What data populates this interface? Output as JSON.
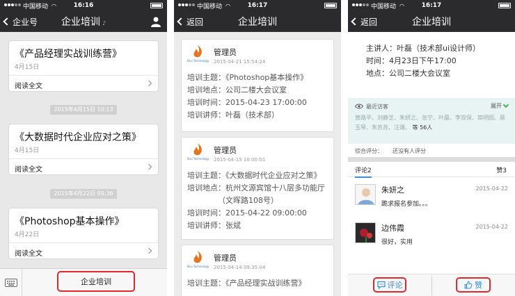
{
  "status": {
    "carrier": "中国移动",
    "times": [
      "16:16",
      "16:17",
      "16:17"
    ]
  },
  "screen1": {
    "nav_back": "企业号",
    "title": "企业培训",
    "cards": [
      {
        "title": "《产品经理实战训练营》",
        "date": "4月15日",
        "read": "阅读全文"
      },
      {
        "title": "《大数据时代企业应对之策》",
        "date": "4月15日",
        "read": "阅读全文"
      },
      {
        "title": "《Photoshop基本操作》",
        "date": "4月22日",
        "read": "阅读全文"
      }
    ],
    "stamps": [
      "2015年4月15日 10:13",
      "2015年4月22日 09:36"
    ],
    "menu_button": "企业培训"
  },
  "screen2": {
    "nav_back": "返回",
    "title": "企业培训",
    "logo_text": "Bvu Technology",
    "posts": [
      {
        "author": "管理员",
        "time": "2015-04-21 15:54:24",
        "lines": [
          "培训主题：《Photoshop基本操作》",
          "培训地点：公司二楼大会议室",
          "培训时间：2015-04-23 17:00:00",
          "培训讲师：叶磊（技术部）"
        ]
      },
      {
        "author": "管理员",
        "time": "2015-04-15 10:00:01",
        "lines": [
          "培训主题：《大数据时代企业应对之策》",
          "培训地点：杭州文源宾馆十八层多功能厅",
          "（文晖路108号）",
          "培训时间：2015-04-22 09:00:00",
          "培训讲师：张斌"
        ]
      },
      {
        "author": "管理员",
        "time": "2015-04-14 09:35:04",
        "lines": [
          "培训主题：《产品经理实战训练营》"
        ]
      }
    ]
  },
  "screen3": {
    "nav_back": "返回",
    "title": "企业培训",
    "info": [
      "主讲人：叶磊（技术部ui设计师）",
      "时间：4月23日下午17:00",
      "地点：公司二楼大会议室"
    ],
    "visitors_label": "最近访客",
    "expand_label": "展开",
    "visitor_names": "黄路平、刘静芝、朱妍之、张宁、叶磊、李双保、简明园、蔡玉琴、朱苏苏、汪珊、",
    "visitor_count": "等 56人",
    "rating_label": "综合评分：",
    "rating_value": "还没有人评分",
    "comments_tab": "评论2",
    "likes_tab": "赞3",
    "comments": [
      {
        "name": "朱妍之",
        "time": "2015-04-22",
        "text": "跪求报名参加。。。"
      },
      {
        "name": "边伟霞",
        "time": "2015-04-22",
        "text": "很好，实用"
      }
    ],
    "comment_button": "评论",
    "like_button": "赞"
  },
  "colors": {
    "nav_bg": "#2b2b2d",
    "highlight": "#e02a2a",
    "link_blue": "#2f8fd8",
    "visitor_bg": "#e8f3f4"
  }
}
